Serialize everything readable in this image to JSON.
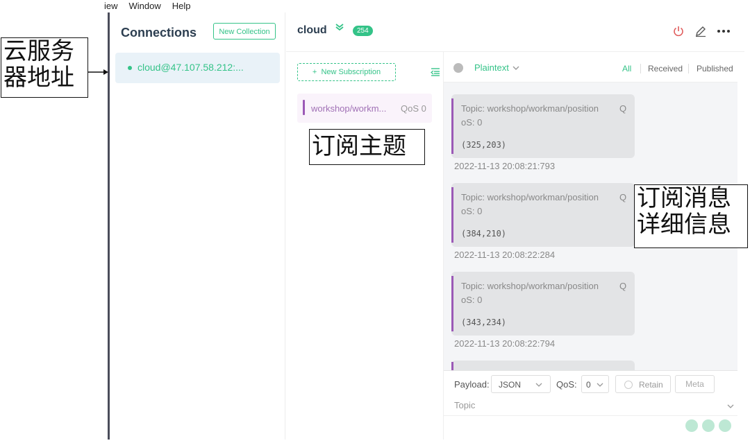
{
  "menu": [
    "iew",
    "Window",
    "Help"
  ],
  "sidebar": {
    "title": "Connections",
    "new_collection": "New Collection",
    "connection": "cloud@47.107.58.212:..."
  },
  "header": {
    "title": "cloud",
    "badge": "254"
  },
  "subscriptions": {
    "new_button": "New Subscription",
    "items": [
      {
        "topic": "workshop/workm...",
        "qos": "QoS 0",
        "color": "#9b59b6"
      }
    ]
  },
  "messages": {
    "format": "Plaintext",
    "filters": {
      "all": "All",
      "received": "Received",
      "published": "Published"
    },
    "items": [
      {
        "topic": "Topic: workshop/workman/position",
        "q": "Q",
        "qos": "oS: 0",
        "payload": "(325,203)",
        "time": "2022-11-13 20:08:21:793"
      },
      {
        "topic": "Topic: workshop/workman/position",
        "q": "Q",
        "qos": "oS: 0",
        "payload": "(384,210)",
        "time": "2022-11-13 20:08:22:284"
      },
      {
        "topic": "Topic: workshop/workman/position",
        "q": "Q",
        "qos": "oS: 0",
        "payload": "(343,234)",
        "time": "2022-11-13 20:08:22:794"
      }
    ]
  },
  "publish": {
    "payload_label": "Payload:",
    "payload_format": "JSON",
    "qos_label": "QoS:",
    "qos_value": "0",
    "retain": "Retain",
    "meta": "Meta",
    "topic_placeholder": "Topic"
  },
  "annotations": {
    "server_line1": "云服务",
    "server_line2": "器地址",
    "subscribe_topic": "订阅主题",
    "msg_line1": "订阅消息",
    "msg_line2": "详细信息"
  },
  "colors": {
    "accent": "#34c388",
    "topic_purple": "#9b59b6",
    "sidebar_border": "#4a4c5a"
  }
}
